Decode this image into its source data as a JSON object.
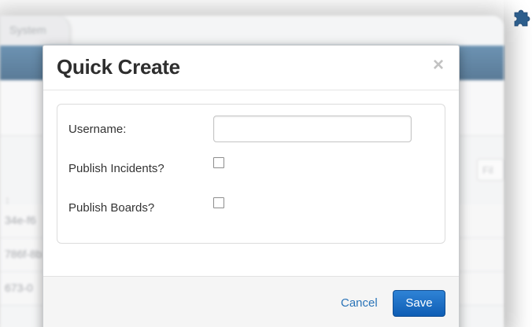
{
  "background": {
    "tab_label": "System",
    "filter_placeholder": "Fil",
    "column_glyph": "↕",
    "rows": [
      "34e-f6",
      "786f-8b",
      "673-0"
    ]
  },
  "modal": {
    "title": "Quick Create",
    "close_glyph": "×",
    "fields": {
      "username_label": "Username:",
      "username_value": "",
      "publish_incidents_label": "Publish Incidents?",
      "publish_incidents_checked": false,
      "publish_boards_label": "Publish Boards?",
      "publish_boards_checked": false
    },
    "footer": {
      "cancel_label": "Cancel",
      "save_label": "Save"
    }
  },
  "icons": {
    "extension": "puzzle-icon"
  },
  "colors": {
    "primary_button": "#1a6cc4",
    "link": "#2a74b8",
    "header_bar": "#2c5a82"
  }
}
